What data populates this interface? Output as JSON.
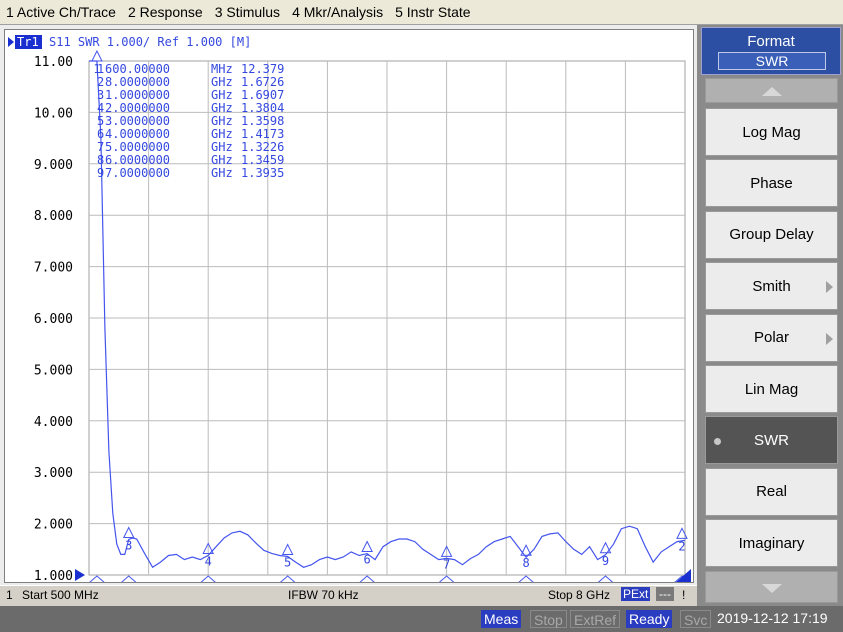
{
  "menu": [
    "1 Active Ch/Trace",
    "2 Response",
    "3 Stimulus",
    "4 Mkr/Analysis",
    "5 Instr State"
  ],
  "trace_header": {
    "tag": "Tr1",
    "text": "S11  SWR 1.000/ Ref 1.000 [M]"
  },
  "status": {
    "channel": "1",
    "start": "Start 500 MHz",
    "ifbw": "IFBW 70 kHz",
    "stop": "Stop 8 GHz",
    "pext": "PExt",
    "dash": "---",
    "excl": "!"
  },
  "bottom": {
    "meas": "Meas",
    "stop": "Stop",
    "extref": "ExtRef",
    "ready": "Ready",
    "svc": "Svc",
    "datetime": "2019-12-12 17:19"
  },
  "softkeys": {
    "title": "Format",
    "current": "SWR",
    "items": [
      {
        "label": "Log Mag",
        "submenu": false,
        "active": false
      },
      {
        "label": "Phase",
        "submenu": false,
        "active": false
      },
      {
        "label": "Group Delay",
        "submenu": false,
        "active": false
      },
      {
        "label": "Smith",
        "submenu": true,
        "active": false
      },
      {
        "label": "Polar",
        "submenu": true,
        "active": false
      },
      {
        "label": "Lin Mag",
        "submenu": false,
        "active": false
      },
      {
        "label": "SWR",
        "submenu": false,
        "active": true
      },
      {
        "label": "Real",
        "submenu": false,
        "active": false
      },
      {
        "label": "Imaginary",
        "submenu": false,
        "active": false
      }
    ]
  },
  "colors": {
    "trace": "#4455ee",
    "grid": "#bbbbbb",
    "active_key": "#545454"
  },
  "chart_data": {
    "type": "line",
    "ylim": [
      1.0,
      11.0
    ],
    "xlim": [
      0.5,
      8.0
    ],
    "x_unit": "GHz",
    "ytick_labels": [
      "11.00",
      "10.00",
      "9.000",
      "8.000",
      "7.000",
      "6.000",
      "5.000",
      "4.000",
      "3.000",
      "2.000",
      "1.000"
    ],
    "series": [
      {
        "x": [
          0.5,
          0.52,
          0.55,
          0.58,
          0.6,
          0.65,
          0.7,
          0.75,
          0.8,
          0.85,
          0.9,
          0.95,
          1.0,
          1.05,
          1.1,
          1.2,
          1.3,
          1.4,
          1.5,
          1.6,
          1.7,
          1.8,
          1.9,
          2.0,
          2.1,
          2.2,
          2.3,
          2.4,
          2.5,
          2.6,
          2.7,
          2.8,
          2.9,
          3.0,
          3.1,
          3.2,
          3.3,
          3.4,
          3.5,
          3.6,
          3.7,
          3.8,
          3.9,
          4.0,
          4.1,
          4.2,
          4.3,
          4.4,
          4.5,
          4.6,
          4.7,
          4.8,
          4.9,
          5.0,
          5.1,
          5.2,
          5.3,
          5.4,
          5.5,
          5.6,
          5.7,
          5.8,
          5.9,
          6.0,
          6.1,
          6.2,
          6.3,
          6.4,
          6.5,
          6.6,
          6.7,
          6.8,
          6.9,
          7.0,
          7.1,
          7.2,
          7.3,
          7.4,
          7.5,
          7.6,
          7.7,
          7.8,
          7.9,
          8.0
        ],
        "y": [
          11.0,
          11.0,
          12.0,
          12.3,
          12.379,
          9.5,
          5.8,
          3.4,
          2.2,
          1.6,
          1.4,
          1.4,
          1.6907,
          1.72,
          1.7,
          1.42,
          1.15,
          1.25,
          1.38,
          1.4,
          1.3,
          1.35,
          1.3,
          1.3804,
          1.55,
          1.72,
          1.82,
          1.85,
          1.78,
          1.62,
          1.48,
          1.42,
          1.38,
          1.3598,
          1.25,
          1.15,
          1.2,
          1.3,
          1.35,
          1.3,
          1.35,
          1.45,
          1.38,
          1.4173,
          1.3,
          1.55,
          1.65,
          1.7,
          1.7,
          1.65,
          1.5,
          1.4,
          1.3,
          1.3226,
          1.3,
          1.2,
          1.32,
          1.4,
          1.55,
          1.65,
          1.7,
          1.75,
          1.55,
          1.3459,
          1.5,
          1.75,
          1.8,
          1.82,
          1.65,
          1.5,
          1.4,
          1.55,
          1.3,
          1.3935,
          1.6,
          1.9,
          1.95,
          1.9,
          1.55,
          1.25,
          1.45,
          1.55,
          1.65,
          1.6726
        ]
      }
    ],
    "markers": [
      {
        "id": "1",
        "freq": "600.00000 MHz",
        "value": "12.379",
        "x": 0.6,
        "y": 12.379
      },
      {
        "id": "2",
        "freq": "8.0000000 GHz",
        "value": "1.6726",
        "x": 8.0,
        "y": 1.6726
      },
      {
        "id": "3",
        "freq": "1.0000000 GHz",
        "value": "1.6907",
        "x": 1.0,
        "y": 1.6907
      },
      {
        "id": "4",
        "freq": "2.0000000 GHz",
        "value": "1.3804",
        "x": 2.0,
        "y": 1.3804
      },
      {
        "id": "5",
        "freq": "3.0000000 GHz",
        "value": "1.3598",
        "x": 3.0,
        "y": 1.3598
      },
      {
        "id": "6",
        "freq": "4.0000000 GHz",
        "value": "1.4173",
        "x": 4.0,
        "y": 1.4173
      },
      {
        "id": "7",
        "freq": "5.0000000 GHz",
        "value": "1.3226",
        "x": 5.0,
        "y": 1.3226
      },
      {
        "id": "8",
        "freq": "6.0000000 GHz",
        "value": "1.3459",
        "x": 6.0,
        "y": 1.3459
      },
      {
        "id": "9",
        "freq": "7.0000000 GHz",
        "value": "1.3935",
        "x": 7.0,
        "y": 1.3935
      }
    ]
  }
}
